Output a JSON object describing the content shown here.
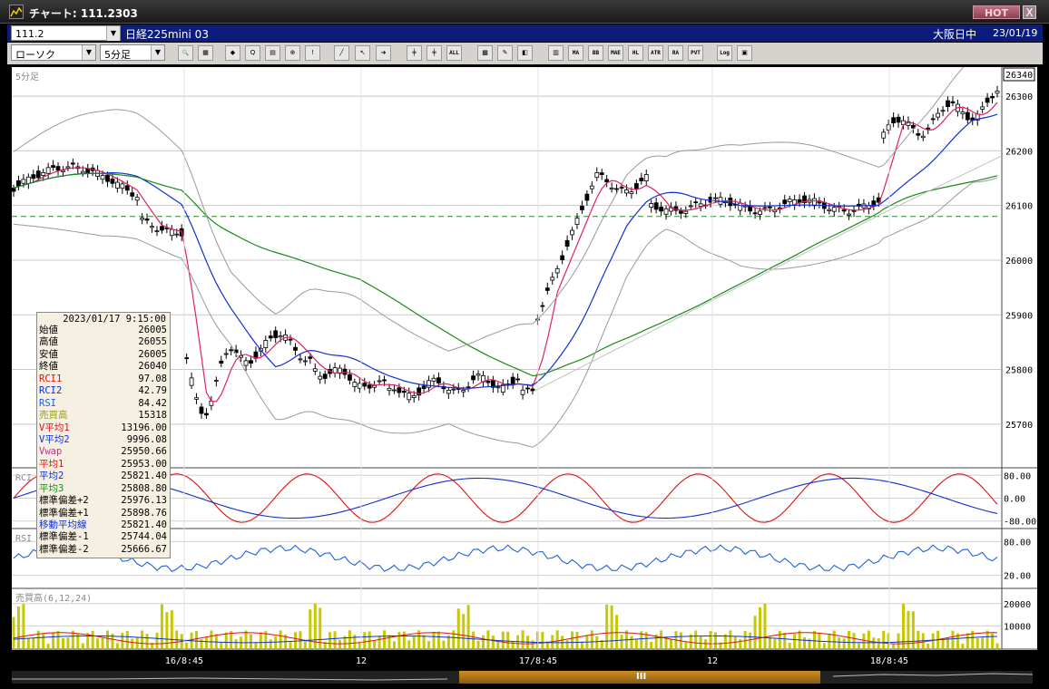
{
  "window": {
    "title": "チャート: 111.2303",
    "hot_label": "HOT",
    "close_label": "X"
  },
  "infobar": {
    "code_value": "111.2",
    "symbol_name": "日経225mini 03",
    "market_status": "大阪日中",
    "date": "23/01/19"
  },
  "toolbar": {
    "chart_type": "ローソク",
    "period": "5分足",
    "buttons": [
      {
        "name": "zoom-button",
        "label": "🔍"
      },
      {
        "name": "layout-button",
        "label": "▦"
      },
      {
        "name": "tool-a-button",
        "label": "◆"
      },
      {
        "name": "tool-b-button",
        "label": "Q"
      },
      {
        "name": "tool-c-button",
        "label": "▤"
      },
      {
        "name": "tool-d-button",
        "label": "⊕"
      },
      {
        "name": "tool-e-button",
        "label": "!"
      },
      {
        "name": "draw-line-button",
        "label": "╱"
      },
      {
        "name": "cursor-button",
        "label": "↖"
      },
      {
        "name": "arrow-button",
        "label": "➜"
      },
      {
        "name": "candle-a-button",
        "label": "╪"
      },
      {
        "name": "candle-b-button",
        "label": "╪"
      },
      {
        "name": "all-button",
        "label": "ALL"
      },
      {
        "name": "grid-tool-button",
        "label": "▩"
      },
      {
        "name": "wrench-button",
        "label": "✎"
      },
      {
        "name": "color-button",
        "label": "◧"
      },
      {
        "name": "chart-mode-button",
        "label": "▥"
      },
      {
        "name": "ma-button",
        "label": "MA"
      },
      {
        "name": "bb-button",
        "label": "BB"
      },
      {
        "name": "mae-button",
        "label": "MAE"
      },
      {
        "name": "hl-button",
        "label": "HL"
      },
      {
        "name": "atr-button",
        "label": "ATR"
      },
      {
        "name": "ra-button",
        "label": "RA"
      },
      {
        "name": "pvt-button",
        "label": "PVT"
      },
      {
        "name": "log-button",
        "label": "Log"
      },
      {
        "name": "export-button",
        "label": "▣"
      }
    ]
  },
  "chart": {
    "period_label": "5分足",
    "current_price": "26340",
    "price_ticks": [
      "26300",
      "26200",
      "26100",
      "26000",
      "25900",
      "25800",
      "25700"
    ],
    "rci_label": "RCI",
    "rci_ticks": [
      "80.00",
      "0.00",
      "-80.00"
    ],
    "rsi_label": "RSI",
    "rsi_ticks": [
      "80.00",
      "20.00"
    ],
    "volume_label": "売買高(6,12,24)",
    "volume_ticks": [
      "20000",
      "10000"
    ],
    "x_labels": [
      "16/8:45",
      "12",
      "17/8:45",
      "12",
      "18/8:45"
    ],
    "colors": {
      "ma_short": "#e0206a",
      "ma_mid": "#1030d0",
      "ma_long": "#1a8a1a",
      "bollinger": "#9a9a9a",
      "rci1": "#e01010",
      "rci2": "#1030d0",
      "rsi": "#2060e0",
      "volume": "#c8c800",
      "dashed_ref": "#2a8a2a"
    }
  },
  "data_panel": {
    "header": "2023/01/17 9:15:00",
    "rows": [
      {
        "key": "始値",
        "value": "26005",
        "color": "#000000"
      },
      {
        "key": "高値",
        "value": "26055",
        "color": "#000000"
      },
      {
        "key": "安値",
        "value": "26005",
        "color": "#000000"
      },
      {
        "key": "終値",
        "value": "26040",
        "color": "#000000"
      },
      {
        "key": "RCI1",
        "value": "97.08",
        "color": "#e01010"
      },
      {
        "key": "RCI2",
        "value": "42.79",
        "color": "#1030d0"
      },
      {
        "key": "RSI",
        "value": "84.42",
        "color": "#2060e0"
      },
      {
        "key": "売買高",
        "value": "15318",
        "color": "#a0a000"
      },
      {
        "key": "V平均1",
        "value": "13196.00",
        "color": "#e01010"
      },
      {
        "key": "V平均2",
        "value": "9996.08",
        "color": "#1030d0"
      },
      {
        "key": "Vwap",
        "value": "25950.66",
        "color": "#c03090"
      },
      {
        "key": "平均1",
        "value": "25953.00",
        "color": "#e01010"
      },
      {
        "key": "平均2",
        "value": "25821.40",
        "color": "#1030d0"
      },
      {
        "key": "平均3",
        "value": "25808.80",
        "color": "#1a8a1a"
      },
      {
        "key": "標準偏差+2",
        "value": "25976.13",
        "color": "#000000"
      },
      {
        "key": "標準偏差+1",
        "value": "25898.76",
        "color": "#000000"
      },
      {
        "key": "移動平均線",
        "value": "25821.40",
        "color": "#1030d0"
      },
      {
        "key": "標準偏差-1",
        "value": "25744.04",
        "color": "#000000"
      },
      {
        "key": "標準偏差-2",
        "value": "25666.67",
        "color": "#000000"
      }
    ]
  },
  "scrollbar": {
    "grip_label": "III"
  }
}
